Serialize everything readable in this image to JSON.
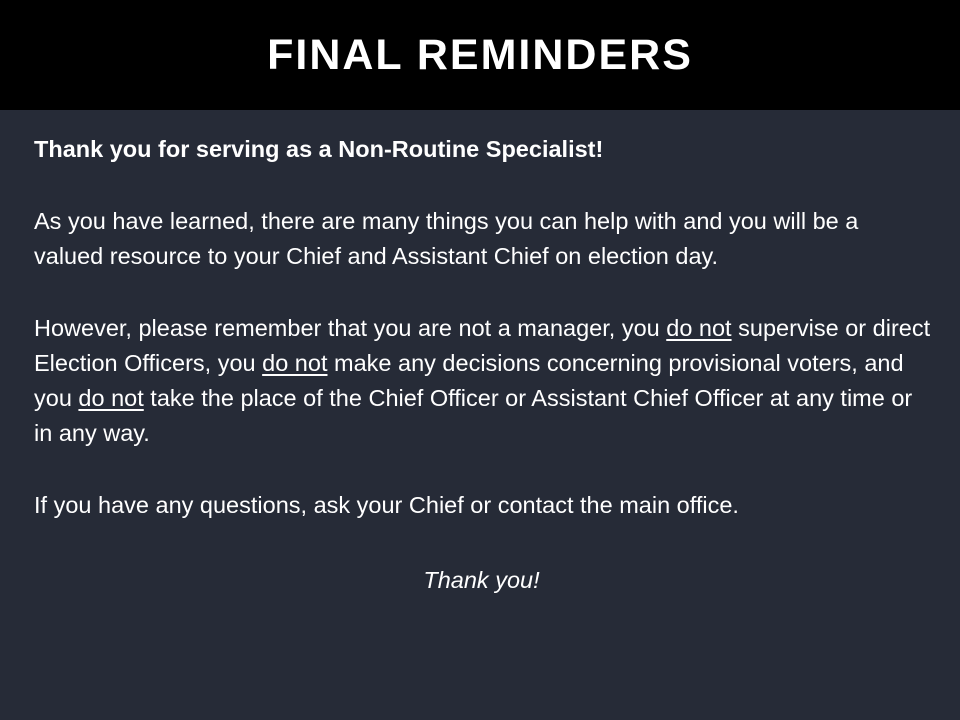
{
  "header": {
    "title": "FINAL REMINDERS"
  },
  "content": {
    "intro": "Thank you for serving as a Non-Routine Specialist!",
    "paragraph_2": "As you have learned, there are many things you can help with and you will be a valued resource to your Chief and Assistant Chief on election day.",
    "paragraph_3": {
      "part_1": "However, please remember that you are not a manager, you ",
      "emphasis_1": "do not",
      "part_2": " supervise or direct Election Officers, you ",
      "emphasis_2": "do not",
      "part_3": " make any decisions concerning provisional voters, and you ",
      "emphasis_3": "do not",
      "part_4": " take the place of the Chief Officer or Assistant Chief Officer at any time or in any way."
    },
    "paragraph_4": "If you have any questions, ask your Chief or contact the main office.",
    "closing": "Thank you!"
  },
  "colors": {
    "header_background": "#000000",
    "body_background": "#262b37",
    "text": "#ffffff"
  }
}
